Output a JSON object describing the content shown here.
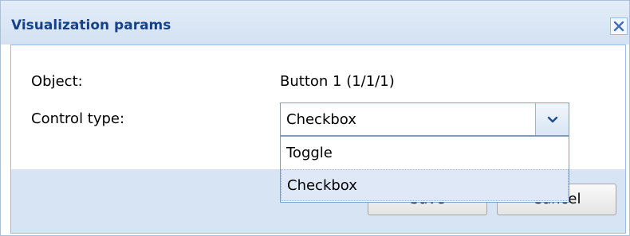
{
  "dialog": {
    "title": "Visualization params",
    "close_icon": "close-icon"
  },
  "form": {
    "object_label": "Object:",
    "object_value": "Button 1 (1/1/1)",
    "control_type_label": "Control type:",
    "control_type_value": "Checkbox",
    "dropdown_icon": "chevron-down-icon",
    "options": [
      "Toggle",
      "Checkbox"
    ],
    "selected_option": "Checkbox"
  },
  "footer": {
    "save_label": "Save",
    "cancel_label": "Cancel"
  },
  "colors": {
    "title_text": "#15428b",
    "titlebar_bg": "#dde8f5",
    "footer_bg": "#d7e4f3",
    "selected_option_bg": "#dfe8f6",
    "close_x": "#3d6fb5",
    "chevron": "#1f4e8c"
  }
}
